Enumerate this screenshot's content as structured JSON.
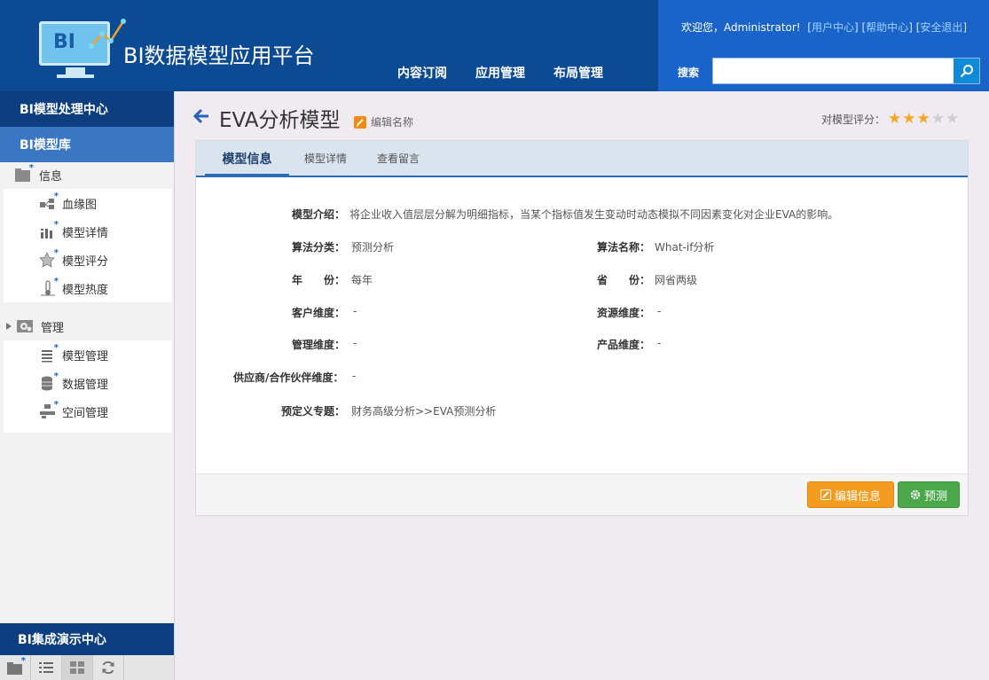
{
  "header": {
    "logo_text": "BI",
    "app_title": "BI数据模型应用平台",
    "nav": [
      "内容订阅",
      "应用管理",
      "布局管理"
    ],
    "welcome_prefix": "欢迎您，Administrator!",
    "links": [
      "用户中心",
      "帮助中心",
      "安全退出"
    ],
    "search_label": "搜索",
    "search_value": ""
  },
  "sidebar": {
    "section_processing": "BI模型处理中心",
    "section_library": "BI模型库",
    "group_info": {
      "label": "信息",
      "items": [
        "血缘图",
        "模型详情",
        "模型评分",
        "模型热度"
      ]
    },
    "group_manage": {
      "label": "管理",
      "items": [
        "模型管理",
        "数据管理",
        "空间管理"
      ]
    },
    "section_demo": "BI集成演示中心"
  },
  "main": {
    "title": "EVA分析模型",
    "edit_name": "编辑名称",
    "rating_label": "对模型评分：",
    "rating_value": 3,
    "rating_max": 5,
    "colors": {
      "star_on": "#f5a623",
      "star_off": "#cfcfcf",
      "accent": "#2b6cb8"
    },
    "tabs": [
      "模型信息",
      "模型详情",
      "查看留言"
    ],
    "active_tab": 0,
    "fields": {
      "intro_label": "模型介绍：",
      "intro_value": "将企业收入值层层分解为明细指标，当某个指标值发生变动时动态模拟不同因素变化对企业EVA的影响。",
      "algo_type_label": "算法分类：",
      "algo_type_value": "预测分析",
      "algo_name_label": "算法名称：",
      "algo_name_value": "What-if分析",
      "year_label_1": "年",
      "year_label_2": "份：",
      "year_value": "每年",
      "province_label_1": "省",
      "province_label_2": "份：",
      "province_value": "网省两级",
      "customer_label": "客户维度：",
      "customer_value": "-",
      "resource_label": "资源维度：",
      "resource_value": "-",
      "manage_label": "管理维度：",
      "manage_value": "-",
      "product_label": "产品维度：",
      "product_value": "-",
      "supplier_label": "供应商/合作伙伴维度：",
      "supplier_value": "-",
      "topic_label": "预定义专题：",
      "topic_value": "财务高级分析>>EVA预测分析"
    },
    "buttons": {
      "edit": "编辑信息",
      "predict": "预测"
    }
  }
}
